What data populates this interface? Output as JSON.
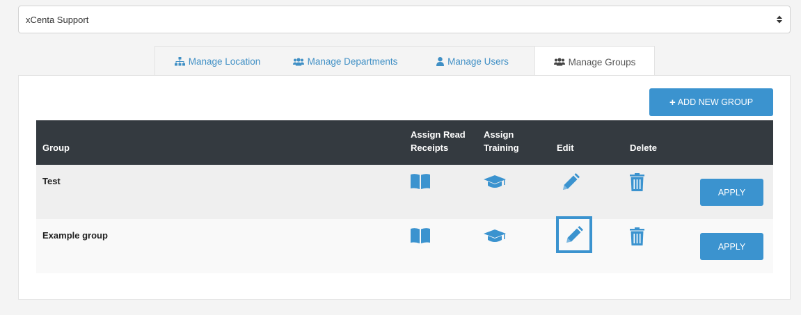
{
  "org_select": {
    "value": "xCenta Support"
  },
  "tabs": [
    {
      "label": "Manage Location",
      "icon": "sitemap-icon",
      "active": false
    },
    {
      "label": "Manage Departments",
      "icon": "users-icon",
      "active": false
    },
    {
      "label": "Manage Users",
      "icon": "user-icon",
      "active": false
    },
    {
      "label": "Manage Groups",
      "icon": "users-icon",
      "active": true
    }
  ],
  "toolbar": {
    "add_label": "ADD NEW GROUP"
  },
  "table": {
    "headers": {
      "group": "Group",
      "assign_read_1": "Assign Read",
      "assign_read_2": "Receipts",
      "assign_training_1": "Assign",
      "assign_training_2": "Training",
      "edit": "Edit",
      "delete": "Delete"
    },
    "rows": [
      {
        "name": "Test",
        "apply_label": "APPLY"
      },
      {
        "name": "Example group",
        "apply_label": "APPLY"
      }
    ]
  },
  "colors": {
    "accent": "#3b93cf",
    "header_bg": "#343a40",
    "link": "#3f8fc5"
  }
}
